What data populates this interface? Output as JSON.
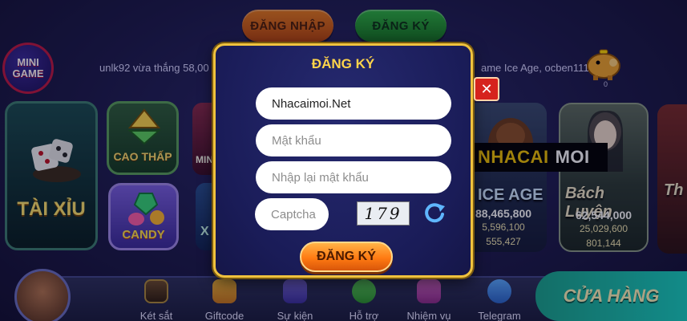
{
  "top_buttons": {
    "login": "ĐĂNG NHẬP",
    "register": "ĐĂNG KÝ"
  },
  "mini_game": {
    "line1": "MINI",
    "line2": "GAME"
  },
  "ticker": {
    "left": "unlk92 vừa thắng  58,00",
    "right": "ame Ice Age, ocben111"
  },
  "piggy": {
    "count": "0"
  },
  "games": {
    "taixiu": "TÀI XỈU",
    "caothap": "CAO THẤP",
    "candy": "CANDY",
    "mini": "MIN",
    "xo": "X",
    "iceage": {
      "name": "ICE AGE",
      "jackpots": [
        "88,465,800",
        "5,596,100",
        "555,427"
      ]
    },
    "bachluyen": {
      "name": "Bách Luyện",
      "jackpots": [
        "62,544,000",
        "25,029,600",
        "801,144"
      ]
    },
    "thien": "Th"
  },
  "watermark": {
    "part1": "NHACAI",
    "part2": "MOI"
  },
  "modal": {
    "title": "ĐĂNG KÝ",
    "username": {
      "value": "Nhacaimoi.Net"
    },
    "password": {
      "placeholder": "Mật khẩu"
    },
    "confirm": {
      "placeholder": "Nhập lại mật khẩu"
    },
    "captcha": {
      "placeholder": "Captcha",
      "image_text": "179"
    },
    "submit": "ĐĂNG KÝ",
    "close": "✕"
  },
  "bottom_nav": [
    "Két sắt",
    "Giftcode",
    "Sự kiện",
    "Hỗ trợ",
    "Nhiệm vụ",
    "Telegram"
  ],
  "shop": "CỬA HÀNG",
  "colors": {
    "accent_gold": "#ffd44a",
    "modal_bg": "#1a1c58",
    "close_red": "#d6231d"
  }
}
